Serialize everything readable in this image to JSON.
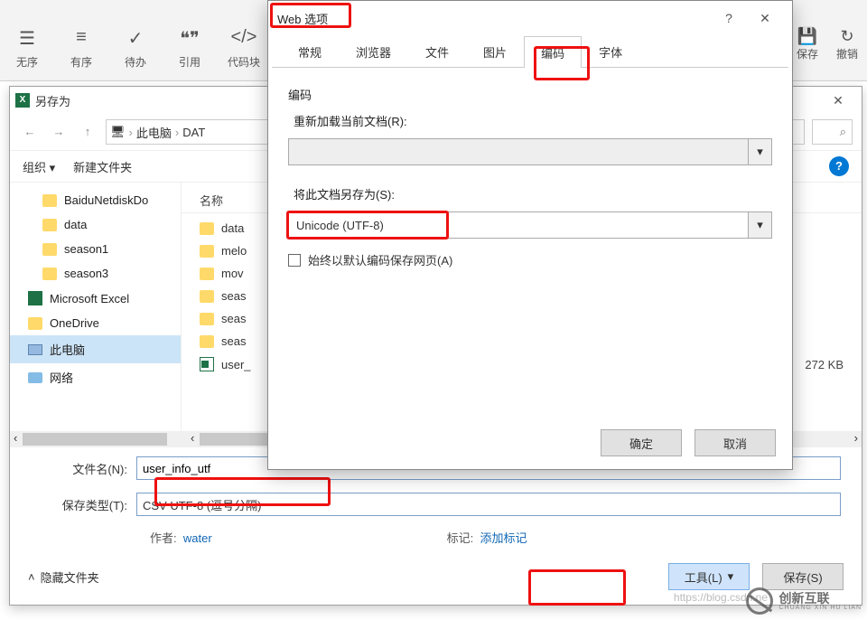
{
  "ribbon": {
    "items": [
      {
        "icon": "☰",
        "label": "无序"
      },
      {
        "icon": "≡",
        "label": "有序"
      },
      {
        "icon": "✓",
        "label": "待办"
      },
      {
        "icon": "❝❞",
        "label": "引用"
      },
      {
        "icon": "</>",
        "label": "代码块"
      }
    ],
    "right": [
      {
        "icon": "💾",
        "label": "保存"
      },
      {
        "icon": "↻",
        "label": "撤销"
      }
    ]
  },
  "saveas": {
    "title": "另存为",
    "crumbs": [
      "此电脑",
      "DAT"
    ],
    "toolbar": {
      "org": "组织",
      "newf": "新建文件夹"
    },
    "nav": [
      {
        "label": "BaiduNetdiskDo",
        "type": "f"
      },
      {
        "label": "data",
        "type": "f"
      },
      {
        "label": "season1",
        "type": "f"
      },
      {
        "label": "season3",
        "type": "f"
      },
      {
        "label": "Microsoft Excel",
        "type": "xl"
      },
      {
        "label": "OneDrive",
        "type": "f"
      },
      {
        "label": "此电脑",
        "type": "pc"
      },
      {
        "label": "网络",
        "type": "net"
      }
    ],
    "list_head": {
      "name": "名称"
    },
    "list": [
      {
        "label": "data",
        "type": "f"
      },
      {
        "label": "melo",
        "type": "f"
      },
      {
        "label": "mov",
        "type": "f"
      },
      {
        "label": "seas",
        "type": "f"
      },
      {
        "label": "seas",
        "type": "f"
      },
      {
        "label": "seas",
        "type": "f"
      },
      {
        "label": "user_",
        "type": "csv",
        "size": "272 KB"
      }
    ],
    "fields": {
      "fname_label": "文件名(N):",
      "fname": "user_info_utf",
      "ftype_label": "保存类型(T):",
      "ftype": "CSV UTF-8 (逗号分隔)",
      "author_label": "作者:",
      "author": "water",
      "tags_label": "标记:",
      "tags": "添加标记"
    },
    "footer": {
      "hide": "隐藏文件夹",
      "tools": "工具(L)",
      "save": "保存(S)"
    }
  },
  "webopt": {
    "title": "Web 选项",
    "help": "?",
    "close": "✕",
    "tabs": [
      "常规",
      "浏览器",
      "文件",
      "图片",
      "编码",
      "字体"
    ],
    "active_tab": "编码",
    "sec1": "编码",
    "reload_label": "重新加载当前文档(R):",
    "reload_value": "",
    "saveas_label": "将此文档另存为(S):",
    "saveas_value": "Unicode (UTF-8)",
    "always_label": "始终以默认编码保存网页(A)",
    "ok": "确定",
    "cancel": "取消"
  },
  "watermark": {
    "brand": "创新互联",
    "sub": "CHUANG XIN HU LIAN",
    "csdn": "https://blog.csdn.ne"
  }
}
